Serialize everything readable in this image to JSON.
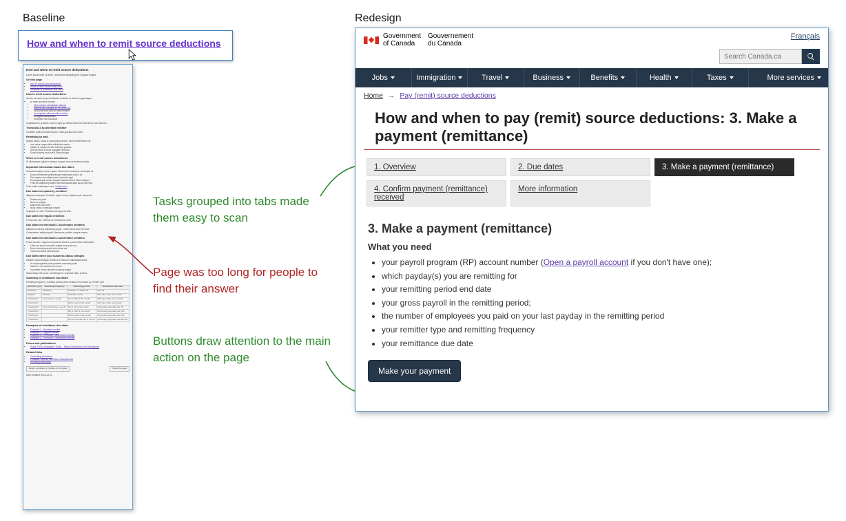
{
  "labels": {
    "baseline": "Baseline",
    "redesign": "Redesign"
  },
  "baseline": {
    "link_text": "How and when to remit source deductions",
    "page": {
      "title": "How and when to remit source deductions",
      "on_this_page": "On this page",
      "sections": [
        "How to remit source deductions",
        "Threshold 2 accelerated remitter",
        "Remitting by mail",
        "When to remit source deductions",
        "Important information about due dates",
        "Due dates for quarterly remitters",
        "Due dates for regular remitters",
        "Due dates for threshold 1 accelerated remitters",
        "Due dates for threshold 2 accelerated remitters",
        "Due dates when your business status changes",
        "Summary of remittance due dates",
        "Examples of remittance due dates",
        "Forms and publications",
        "Related links"
      ],
      "table_caption": "Remitting frequency, remitting periods and remittance due dates by remitter type",
      "table_headers": [
        "Remitter type",
        "Remitting frequency",
        "Remitting period",
        "Remittance due date"
      ],
      "table_rows": [
        [
          "Quarterly",
          "Quarterly",
          "January 1 to March 31",
          "April 15"
        ],
        [
          "Regular",
          "Monthly",
          "Calendar month",
          "15th day of the next month"
        ],
        [
          "Threshold 1",
          "Up to twice a month",
          "1st to 15th of the month",
          "25th day of the same month"
        ],
        [
          "Threshold 1",
          "",
          "16th to end of the month",
          "10th day of the next month"
        ],
        [
          "Threshold 2",
          "Up to four times a month",
          "1st to 7th of the month",
          "3rd working day after the 7th"
        ],
        [
          "Threshold 2",
          "",
          "8th to 14th of the month",
          "3rd working day after the 14th"
        ],
        [
          "Threshold 2",
          "",
          "15th to 21st of the month",
          "3rd working day after the 21st"
        ],
        [
          "Threshold 2",
          "",
          "22nd to the last day of month",
          "3rd working day after the last day"
        ]
      ],
      "report_btn": "Report a problem or mistake on this page",
      "share_btn": "Share this page",
      "date_modified": "Date modified: 2018-12-21"
    }
  },
  "annotations": {
    "tabs": "Tasks grouped into tabs made them easy to scan",
    "too_long": "Page was too long for people to find their answer",
    "buttons": "Buttons draw attention to the main action on the page"
  },
  "redesign": {
    "goc_en": "Government\nof Canada",
    "goc_fr": "Gouvernement\ndu Canada",
    "lang_link": "Français",
    "search_placeholder": "Search Canada.ca",
    "nav": [
      "Jobs",
      "Immigration",
      "Travel",
      "Business",
      "Benefits",
      "Health",
      "Taxes",
      "More services"
    ],
    "breadcrumb": {
      "home": "Home",
      "parent": "Pay (remit) source deductions"
    },
    "h1": "How and when to pay (remit) source deductions: 3. Make a payment (remittance)",
    "tabs": [
      "1. Overview",
      "2. Due dates",
      "3. Make a payment (remittance)",
      "4. Confirm payment (remittance) received",
      "More information"
    ],
    "h2": "3. Make a payment (remittance)",
    "h3": "What you need",
    "inline_link": "Open a payroll account",
    "list": [
      [
        "your payroll program (RP) account number (",
        " if you don't have one);"
      ],
      "which payday(s) you are remitting for",
      "your remitting period end date",
      "your gross payroll in the remitting period;",
      "the number of employees you paid on your last payday in the remitting period",
      "your remitter type and remitting frequency",
      "your remittance due date"
    ],
    "cta": "Make your payment"
  }
}
